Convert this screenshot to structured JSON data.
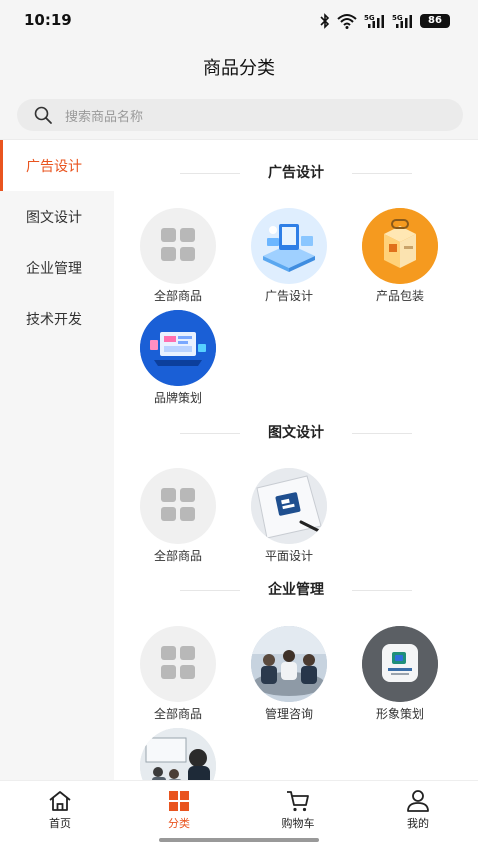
{
  "status": {
    "time": "10:19",
    "battery": "86",
    "signal_1": "5G",
    "signal_2": "5G"
  },
  "header": {
    "title": "商品分类"
  },
  "search": {
    "placeholder": "搜索商品名称"
  },
  "sidebar": {
    "items": [
      {
        "label": "广告设计",
        "active": true
      },
      {
        "label": "图文设计",
        "active": false
      },
      {
        "label": "企业管理",
        "active": false
      },
      {
        "label": "技术开发",
        "active": false
      }
    ]
  },
  "sections": [
    {
      "title": "广告设计",
      "items": [
        {
          "label": "全部商品",
          "icon": "grid-icon"
        },
        {
          "label": "广告设计",
          "icon": "isometric-devices-image"
        },
        {
          "label": "产品包装",
          "icon": "package-box-image"
        },
        {
          "label": "品牌策划",
          "icon": "laptop-dashboard-image"
        }
      ]
    },
    {
      "title": "图文设计",
      "items": [
        {
          "label": "全部商品",
          "icon": "grid-icon"
        },
        {
          "label": "平面设计",
          "icon": "logo-sketch-image"
        }
      ]
    },
    {
      "title": "企业管理",
      "items": [
        {
          "label": "全部商品",
          "icon": "grid-icon"
        },
        {
          "label": "管理咨询",
          "icon": "meeting-photo-image"
        },
        {
          "label": "形象策划",
          "icon": "brand-tile-image"
        },
        {
          "label": "",
          "icon": "training-room-image"
        }
      ]
    }
  ],
  "tabbar": {
    "items": [
      {
        "label": "首页",
        "icon": "home-icon",
        "active": false
      },
      {
        "label": "分类",
        "icon": "category-icon",
        "active": true
      },
      {
        "label": "购物车",
        "icon": "cart-icon",
        "active": false
      },
      {
        "label": "我的",
        "icon": "user-icon",
        "active": false
      }
    ]
  },
  "colors": {
    "accent": "#e9541f",
    "background": "#f5f5f5",
    "sidebar": "#f6f6f6"
  }
}
